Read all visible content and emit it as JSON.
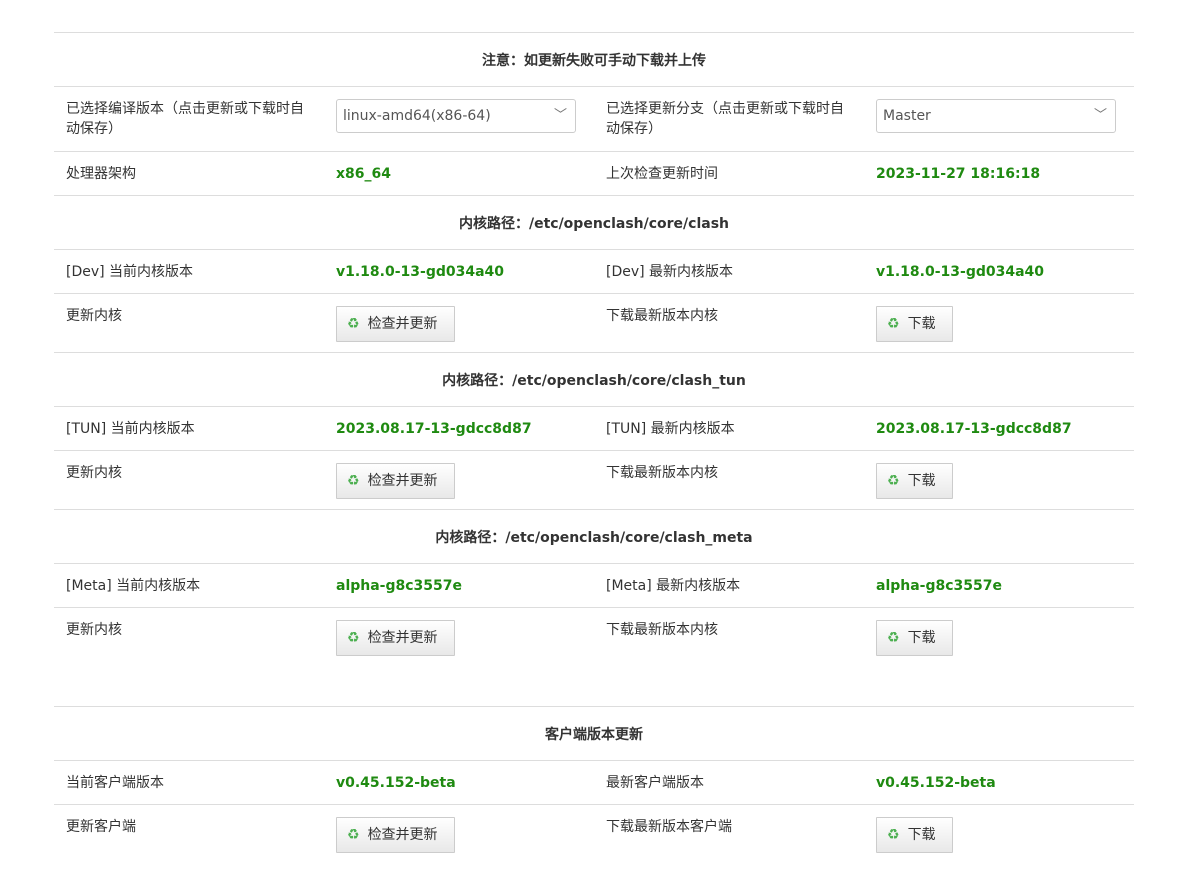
{
  "notice": "注意：如更新失败可手动下载并上传",
  "compile": {
    "label": "已选择编译版本（点击更新或下载时自动保存）",
    "value": "linux-amd64(x86-64)",
    "branch_label": "已选择更新分支（点击更新或下载时自动保存）",
    "branch_value": "Master"
  },
  "arch": {
    "label": "处理器架构",
    "value": "x86_64",
    "check_label": "上次检查更新时间",
    "check_value": "2023-11-27 18:16:18"
  },
  "dev": {
    "path": "内核路径：/etc/openclash/core/clash",
    "current_label": "[Dev] 当前内核版本",
    "current_value": "v1.18.0-13-gd034a40",
    "latest_label": "[Dev] 最新内核版本",
    "latest_value": "v1.18.0-13-gd034a40",
    "update_label": "更新内核",
    "update_button": "检查并更新",
    "download_label": "下载最新版本内核",
    "download_button": "下载"
  },
  "tun": {
    "path": "内核路径：/etc/openclash/core/clash_tun",
    "current_label": "[TUN] 当前内核版本",
    "current_value": "2023.08.17-13-gdcc8d87",
    "latest_label": "[TUN] 最新内核版本",
    "latest_value": "2023.08.17-13-gdcc8d87",
    "update_label": "更新内核",
    "update_button": "检查并更新",
    "download_label": "下载最新版本内核",
    "download_button": "下载"
  },
  "meta": {
    "path": "内核路径：/etc/openclash/core/clash_meta",
    "current_label": "[Meta] 当前内核版本",
    "current_value": "alpha-g8c3557e",
    "latest_label": "[Meta] 最新内核版本",
    "latest_value": "alpha-g8c3557e",
    "update_label": "更新内核",
    "update_button": "检查并更新",
    "download_label": "下载最新版本内核",
    "download_button": "下载"
  },
  "client": {
    "title": "客户端版本更新",
    "current_label": "当前客户端版本",
    "current_value": "v0.45.152-beta",
    "latest_label": "最新客户端版本",
    "latest_value": "v0.45.152-beta",
    "update_label": "更新客户端",
    "update_button": "检查并更新",
    "download_label": "下载最新版本客户端",
    "download_button": "下载"
  },
  "icons": {
    "refresh": "♻"
  },
  "colors": {
    "value_green": "#1f8a11",
    "refresh_icon": "#4caf50"
  }
}
